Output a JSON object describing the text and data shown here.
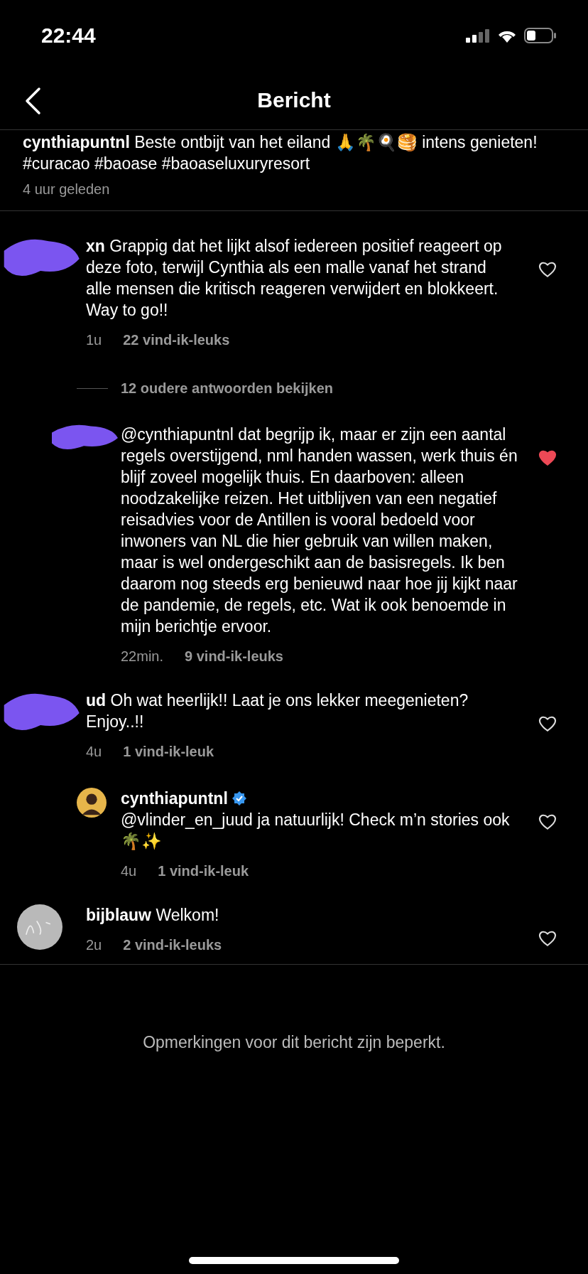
{
  "status_bar": {
    "time": "22:44"
  },
  "header": {
    "title": "Bericht"
  },
  "caption": {
    "text": "**cynthiapuntnl** Beste ontbijt van het eiland 🙏🌴🍳🥞 intens genieten! #curacao #baoase #baoaseluxuryresort",
    "time": "4 uur geleden"
  },
  "thread": [
    {
      "kind": "comment",
      "avatar": {
        "kind": "redacted"
      },
      "verified": false,
      "text": "**xn** Grappig dat het lijkt alsof iedereen positief reageert op deze foto, terwijl Cynthia als een malle vanaf het strand alle mensen die kritisch reageren verwijdert en blokkeert. Way to go!!",
      "time": "1u",
      "likes": "22 vind-ik-leuks",
      "liked": false
    },
    {
      "kind": "more",
      "label": "12 oudere antwoorden bekijken"
    },
    {
      "kind": "reply",
      "avatar": {
        "kind": "redacted"
      },
      "verified": false,
      "text": "@cynthiapuntnl dat begrijp ik, maar er zijn een aantal regels overstijgend, nml handen wassen, werk thuis én blijf zoveel mogelijk thuis. En daarboven: alleen noodzakelijke reizen. Het uitblijven van een negatief reisadvies voor de Antillen is vooral bedoeld voor inwoners van NL die hier gebruik van willen maken, maar is wel ondergeschikt aan de basisregels. Ik ben daarom nog steeds erg benieuwd naar hoe jij kijkt naar de pandemie, de regels, etc. Wat ik ook benoemde in mijn berichtje ervoor.",
      "time": "22min.",
      "likes": "9 vind-ik-leuks",
      "liked": true
    },
    {
      "kind": "comment",
      "avatar": {
        "kind": "redacted"
      },
      "verified": false,
      "text": "**ud** Oh wat heerlijk!! Laat je ons lekker meegenieten? Enjoy..!!",
      "time": "4u",
      "likes": "1 vind-ik-leuk",
      "liked": false
    },
    {
      "kind": "reply",
      "verified": true,
      "name": "cynthiapuntnl",
      "text": "@vlinder_en_juud ja natuurlijk! Check m’n stories ook 🌴✨",
      "time": "4u",
      "likes": "1 vind-ik-leuk",
      "liked": false
    },
    {
      "kind": "comment",
      "avatar": {
        "kind": "logo"
      },
      "verified": false,
      "text": "**bijblauw** Welkom!",
      "time": "2u",
      "likes": "2 vind-ik-leuks",
      "liked": false
    }
  ],
  "footer": {
    "notice": "Opmerkingen voor dit bericht zijn beperkt."
  }
}
